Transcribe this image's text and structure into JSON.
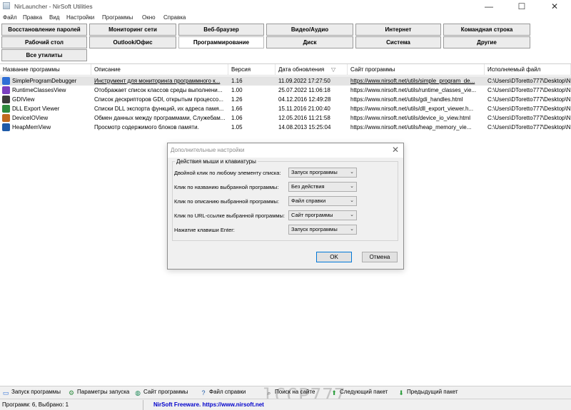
{
  "window": {
    "title": "NirLauncher  -  NirSoft Utilities",
    "buttons": {
      "minimize": "—",
      "maximize": "☐",
      "close": "✕"
    }
  },
  "menu": [
    "Файл",
    "Правка",
    "Вид",
    "Настройки",
    "Программы",
    "Окно",
    "Справка"
  ],
  "category_buttons": [
    "Восстановление паролей",
    "Мониторинг сети",
    "Веб-браузер",
    "Видео/Аудио",
    "Интернет",
    "Командная строка",
    "Рабочий стол",
    "Outlook/Офис",
    "Программирование",
    "Диск",
    "Система",
    "Другие",
    "Все утилиты"
  ],
  "active_category": "Программирование",
  "table": {
    "columns": [
      "Название программы",
      "Описание",
      "Версия",
      "Дата обновления",
      "Сайт программы",
      "Исполняемый файл"
    ],
    "sort_indicator": "▽",
    "rows": [
      {
        "name": "SimpleProgramDebugger",
        "description": "Инструмент для мониторинга программного к...",
        "version": "1.16",
        "date": "11.09.2022 17:27:50",
        "site": "https://www.nirsoft.net/utils/simple_program_de...",
        "exe": "C:\\Users\\DToretto777\\Desktop\\N",
        "icon": "debugger-icon",
        "color": "#2f6fd6",
        "selected": true
      },
      {
        "name": "RuntimeClassesView",
        "description": "Отображает список классов среды выполнени...",
        "version": "1.00",
        "date": "25.07.2022 11:06:18",
        "site": "https://www.nirsoft.net/utils/runtime_classes_vie...",
        "exe": "C:\\Users\\DToretto777\\Desktop\\N",
        "icon": "classes-icon",
        "color": "#7a3fc0",
        "selected": false
      },
      {
        "name": "GDIView",
        "description": "Список дескрипторов GDI, открытым процессо...",
        "version": "1.26",
        "date": "04.12.2016 12:49:28",
        "site": "https://www.nirsoft.net/utils/gdi_handles.html",
        "exe": "C:\\Users\\DToretto777\\Desktop\\N",
        "icon": "gdi-icon",
        "color": "#3b3b3b",
        "selected": false
      },
      {
        "name": "DLL Export Viewer",
        "description": "Списки DLL экспорта функций, их адреса памя...",
        "version": "1.66",
        "date": "15.11.2016 21:00:40",
        "site": "https://www.nirsoft.net/utils/dll_export_viewer.h...",
        "exe": "C:\\Users\\DToretto777\\Desktop\\N",
        "icon": "dll-icon",
        "color": "#2e8b3e",
        "selected": false
      },
      {
        "name": "DeviceIOView",
        "description": "Обмен данных между программами, Служебам...",
        "version": "1.06",
        "date": "12.05.2016 11:21:58",
        "site": "https://www.nirsoft.net/utils/device_io_view.html",
        "exe": "C:\\Users\\DToretto777\\Desktop\\N",
        "icon": "device-icon",
        "color": "#c06a1e",
        "selected": false
      },
      {
        "name": "HeapMemView",
        "description": "Просмотр содержимого блоков памяти.",
        "version": "1.05",
        "date": "14.08.2013 15:25:04",
        "site": "https://www.nirsoft.net/utils/heap_memory_vie...",
        "exe": "C:\\Users\\DToretto777\\Desktop\\N",
        "icon": "heap-icon",
        "color": "#1e5aa8",
        "selected": false
      }
    ]
  },
  "dialog": {
    "title": "Дополнительные настройки",
    "close": "✕",
    "group_label": "Действия мыши и клавиатуры",
    "rows": [
      {
        "label": "Двойной клик по любому элементу списка:",
        "value": "Запуск программы"
      },
      {
        "label": "Клик по названию выбранной программы:",
        "value": "Без действия"
      },
      {
        "label": "Клик по описанию выбранной программы:",
        "value": "Файл справки"
      },
      {
        "label": "Клик по URL-ссылке выбранной программы:",
        "value": "Сайт программы"
      },
      {
        "label": "Нажатие клавиши Enter:",
        "value": "Запуск программы"
      }
    ],
    "ok": "OK",
    "cancel": "Отмена"
  },
  "bottom_actions": [
    {
      "label": "Запуск программы",
      "icon": "run-icon",
      "glyph": "▭",
      "color": "#2d6fd6"
    },
    {
      "label": "Параметры запуска",
      "icon": "launch-params-icon",
      "glyph": "⚙",
      "color": "#2e8b3e"
    },
    {
      "label": "Сайт программы",
      "icon": "globe-icon",
      "glyph": "◍",
      "color": "#1f8a5a"
    },
    {
      "label": "Файл справки",
      "icon": "help-icon",
      "glyph": "?",
      "color": "#1e5aa8"
    },
    {
      "label": "Поиск на сайте",
      "icon": "search-site-icon",
      "glyph": "⌕",
      "color": "#555555"
    },
    {
      "label": "Следующий пакет",
      "icon": "arrow-up-icon",
      "glyph": "⬆",
      "color": "#2e9e3e"
    },
    {
      "label": "Предыдущий пакет",
      "icon": "arrow-down-icon",
      "glyph": "⬇",
      "color": "#2e9e3e"
    }
  ],
  "status": {
    "counts": "Программ: 6, Выбрано: 1",
    "link": "NirSoft Freeware. https://www.nirsoft.net"
  },
  "watermark": "lCCP777"
}
